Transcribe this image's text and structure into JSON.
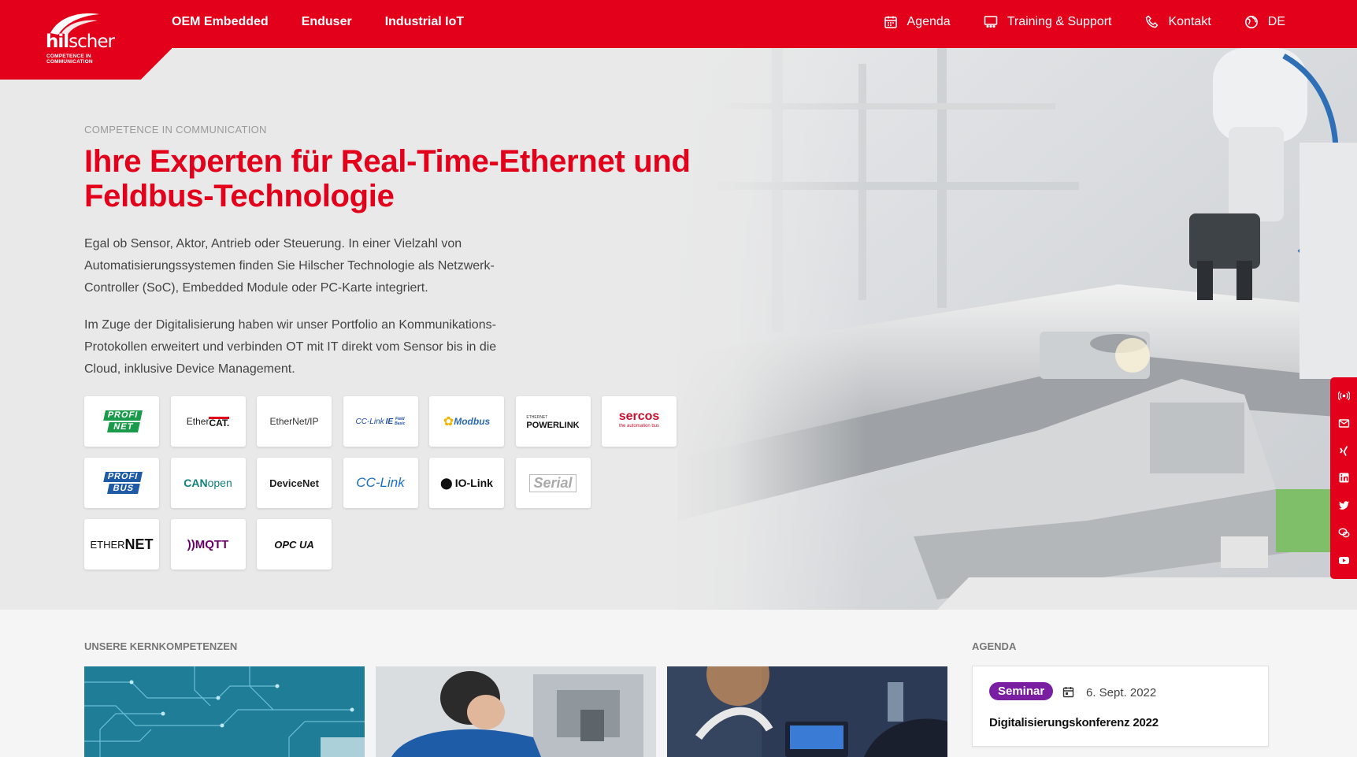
{
  "brand": {
    "logo_word_bold": "hil",
    "logo_word_light": "scher",
    "logo_tagline": "COMPETENCE IN COMMUNICATION",
    "accent_color": "#e2001a"
  },
  "nav": {
    "main": [
      "OEM Embedded",
      "Enduser",
      "Industrial IoT"
    ],
    "agenda": "Agenda",
    "training": "Training & Support",
    "contact": "Kontakt",
    "language": "DE"
  },
  "hero": {
    "eyebrow": "COMPETENCE IN COMMUNICATION",
    "headline": "Ihre Experten für Real-Time-Ethernet und Feldbus-Technologie",
    "paragraph_1": "Egal ob Sensor, Aktor, Antrieb oder Steuerung. In einer Vielzahl von Automatisierungssystemen finden Sie Hilscher Technologie als Netzwerk-Controller (SoC), Embedded Module oder PC-Karte integriert.",
    "paragraph_2": "Im Zuge der Digitalisierung haben wir unser Portfolio an Kommunikations-Protokollen erweitert und verbinden OT mit IT direkt vom Sensor bis in die Cloud, inklusive Device Management."
  },
  "protocols": {
    "profinet": [
      "PROFI",
      "NET"
    ],
    "ethercat": [
      "Ether",
      "CAT."
    ],
    "ethernet_ip": "EtherNet/IP",
    "cc_link_ie": [
      "CC-Link",
      "IE",
      "Field",
      "Basic"
    ],
    "modbus": "Modbus",
    "powerlink": [
      "ETHERNET",
      "POWERLINK"
    ],
    "sercos": [
      "sercos",
      "the automation bus"
    ],
    "profibus": [
      "PROFI",
      "BUS"
    ],
    "canopen": [
      "CAN",
      "open"
    ],
    "devicenet": "DeviceNet",
    "cc_link": "CC-Link",
    "io_link": "IO-Link",
    "serial": "Serial",
    "ethernet": [
      "ETHER",
      "NET"
    ],
    "mqtt": "MQTT",
    "opc_ua": "OPC UA"
  },
  "sections": {
    "kernkompetenzen": "UNSERE KERNKOMPETENZEN",
    "agenda": "AGENDA"
  },
  "agenda_item": {
    "badge": "Seminar",
    "date": "6. Sept. 2022",
    "title": "Digitalisierungskonferenz 2022"
  },
  "social_icons": [
    "podcast-icon",
    "mail-icon",
    "xing-icon",
    "linkedin-icon",
    "twitter-icon",
    "wechat-icon",
    "youtube-icon"
  ]
}
